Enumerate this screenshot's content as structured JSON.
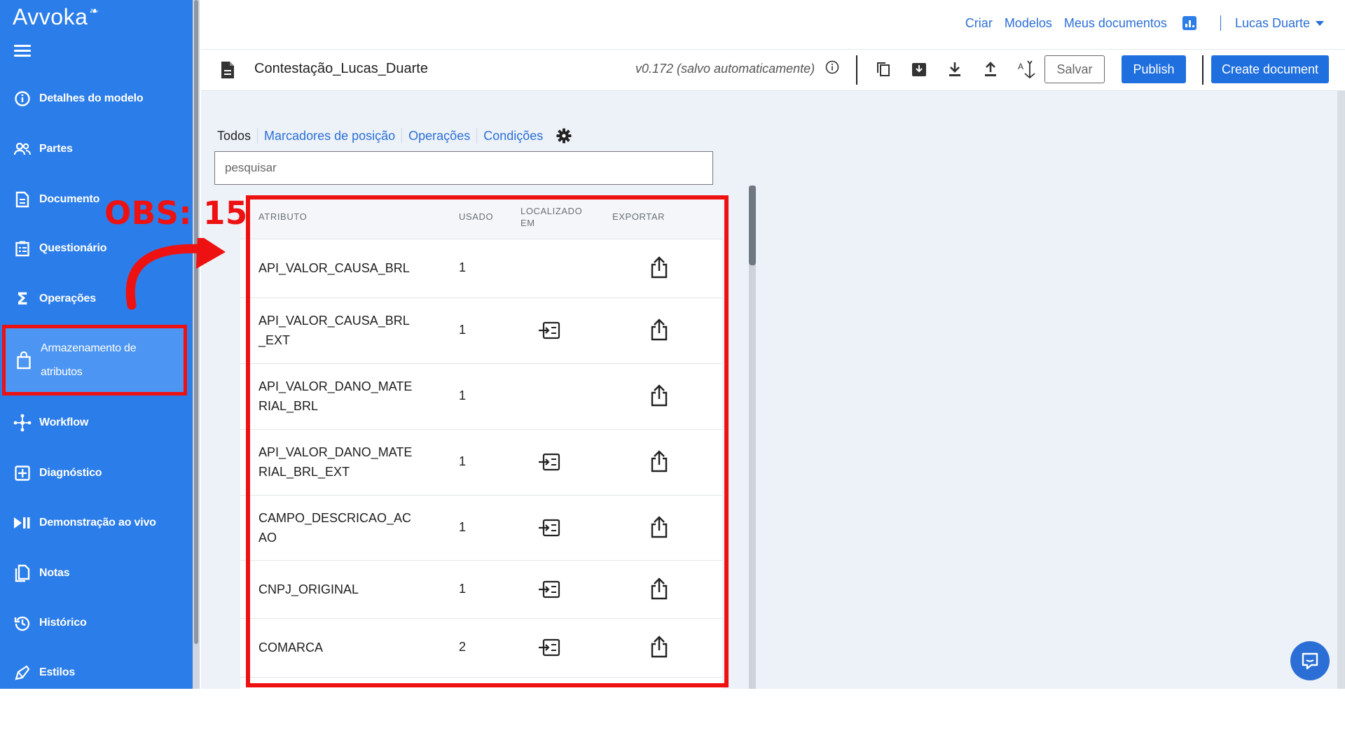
{
  "app": {
    "brand": "Avvoka",
    "brand_mark": "leaf-icon"
  },
  "sidebar": {
    "items": [
      {
        "label": "Detalhes do modelo",
        "icon": "info-circle-icon"
      },
      {
        "label": "Partes",
        "icon": "users-icon"
      },
      {
        "label": "Documento",
        "icon": "document-icon"
      },
      {
        "label": "Questionário",
        "icon": "clipboard-icon"
      },
      {
        "label": "Operações",
        "icon": "sigma-icon"
      },
      {
        "label_line1": "Armazenamento de",
        "label_line2": "atributos",
        "icon": "bag-icon",
        "active": true
      },
      {
        "label": "Workflow",
        "icon": "workflow-icon"
      },
      {
        "label": "Diagnóstico",
        "icon": "plus-box-icon"
      },
      {
        "label": "Demonstração ao vivo",
        "icon": "play-pause-icon"
      },
      {
        "label": "Notas",
        "icon": "notes-icon"
      },
      {
        "label": "Histórico",
        "icon": "history-icon"
      },
      {
        "label": "Estilos",
        "icon": "brush-icon"
      }
    ]
  },
  "topnav": {
    "links": [
      "Criar",
      "Modelos",
      "Meus documentos"
    ],
    "user": "Lucas Duarte"
  },
  "docbar": {
    "title": "Contestação_Lucas_Duarte",
    "version": "v0.172 (salvo automaticamente)",
    "save_label": "Salvar",
    "publish_label": "Publish",
    "create_label": "Create document"
  },
  "tabs": [
    "Todos",
    "Marcadores de posição",
    "Operações",
    "Condições"
  ],
  "search": {
    "placeholder": "pesquisar"
  },
  "table": {
    "headers": {
      "attribute": "ATRIBUTO",
      "used": "USADO",
      "located_l1": "LOCALIZADO",
      "located_l2": "EM",
      "export": "EXPORTAR"
    },
    "rows": [
      {
        "attr_l1": "API_VALOR_CAUSA_BRL",
        "attr_l2": "",
        "used": "1",
        "located": false
      },
      {
        "attr_l1": "API_VALOR_CAUSA_BRL",
        "attr_l2": "_EXT",
        "used": "1",
        "located": true
      },
      {
        "attr_l1": "API_VALOR_DANO_MATE",
        "attr_l2": "RIAL_BRL",
        "used": "1",
        "located": false
      },
      {
        "attr_l1": "API_VALOR_DANO_MATE",
        "attr_l2": "RIAL_BRL_EXT",
        "used": "1",
        "located": true
      },
      {
        "attr_l1": "CAMPO_DESCRICAO_AC",
        "attr_l2": "AO",
        "used": "1",
        "located": true
      },
      {
        "attr_l1": "CNPJ_ORIGINAL",
        "attr_l2": "",
        "used": "1",
        "located": true
      },
      {
        "attr_l1": "COMARCA",
        "attr_l2": "",
        "used": "2",
        "located": true
      }
    ]
  },
  "annotation": {
    "text": "OBS: 15"
  },
  "colors": {
    "sidebar": "#2b7de9",
    "active": "#4c95f2",
    "accent": "#1f6fde",
    "highlight": "#ee1111",
    "background": "#edf2f9"
  }
}
